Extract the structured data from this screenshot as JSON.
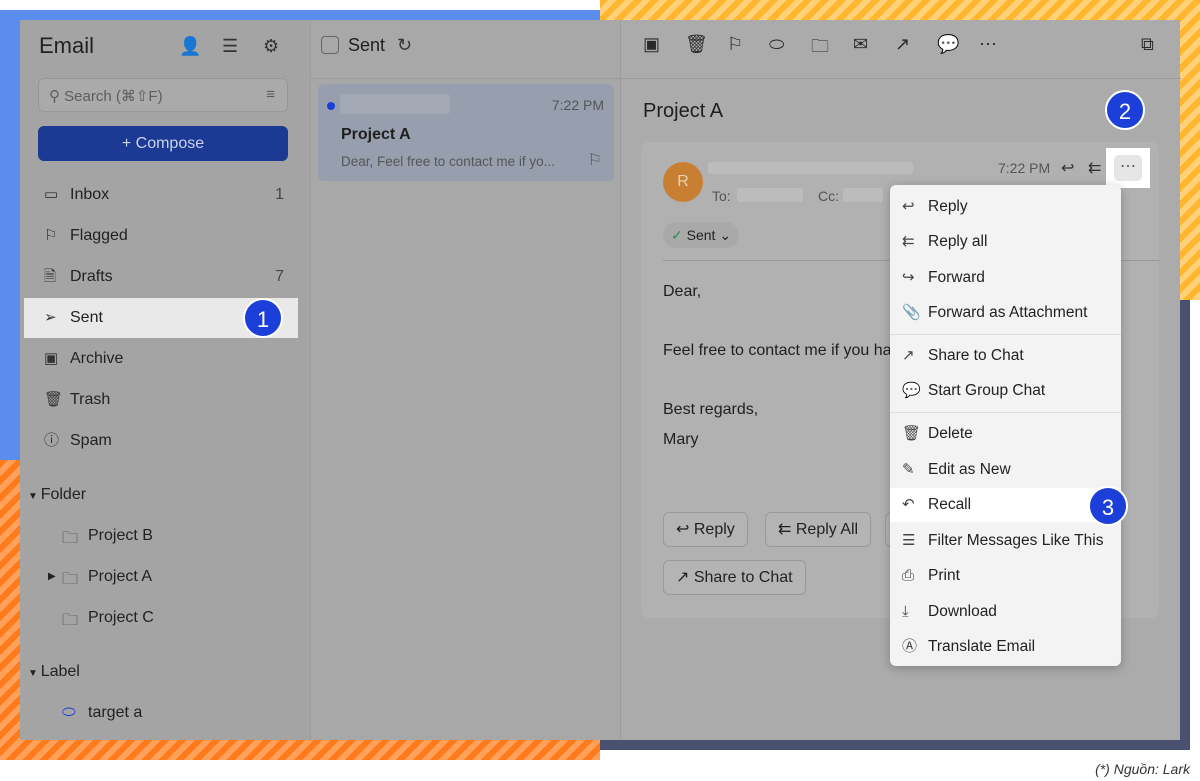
{
  "sidebar": {
    "title": "Email",
    "search_placeholder": "Search (⌘⇧F)",
    "compose": "+ Compose",
    "items": [
      {
        "label": "Inbox",
        "count": "1",
        "icon": "inbox-icon"
      },
      {
        "label": "Flagged",
        "count": "",
        "icon": "flag-icon"
      },
      {
        "label": "Drafts",
        "count": "7",
        "icon": "drafts-icon"
      },
      {
        "label": "Sent",
        "count": "",
        "icon": "send-icon"
      },
      {
        "label": "Archive",
        "count": "",
        "icon": "archive-icon"
      },
      {
        "label": "Trash",
        "count": "",
        "icon": "trash-icon"
      },
      {
        "label": "Spam",
        "count": "",
        "icon": "spam-icon"
      }
    ],
    "folder_header": "Folder",
    "folders": [
      "Project B",
      "Project A",
      "Project C"
    ],
    "label_header": "Label",
    "labels": [
      "target a"
    ]
  },
  "list": {
    "title": "Sent",
    "item": {
      "time": "7:22 PM",
      "subject": "Project A",
      "preview": "Dear, Feel free to contact me if yo..."
    }
  },
  "reader": {
    "subject": "Project A",
    "avatar": "R",
    "time": "7:22 PM",
    "to_label": "To:",
    "cc_label": "Cc:",
    "status": "Sent",
    "body": [
      "Dear,",
      "Feel free to contact me if you have a",
      "Best regards,",
      "Mary"
    ],
    "buttons": [
      "Reply",
      "Reply All",
      "Share to Chat"
    ]
  },
  "menu": {
    "items": [
      "Reply",
      "Reply all",
      "Forward",
      "Forward as Attachment",
      "Share to Chat",
      "Start Group Chat",
      "Delete",
      "Edit as New",
      "Recall",
      "Filter Messages Like This",
      "Print",
      "Download",
      "Translate Email"
    ]
  },
  "badges": [
    "1",
    "2",
    "3"
  ],
  "caption": "(*) Nguồn: Lark",
  "colors": {
    "accent": "#1d3fd9",
    "compose": "#1c3a94"
  }
}
